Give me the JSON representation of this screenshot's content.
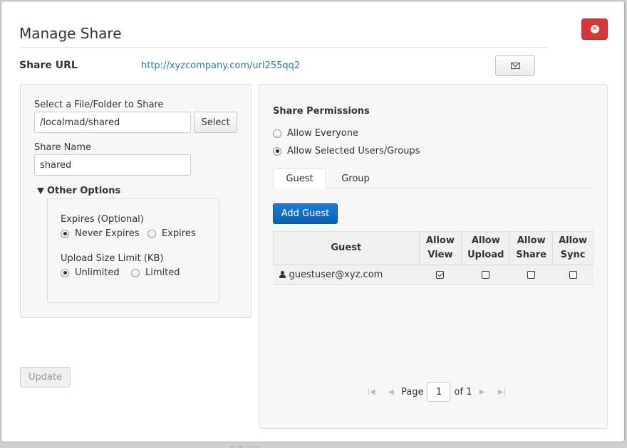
{
  "dialog": {
    "title": "Manage Share",
    "close_icon": "close-circle-icon"
  },
  "share_url": {
    "label": "Share URL",
    "value": "http://xyzcompany.com/url255qq2",
    "email_icon": "envelope-icon"
  },
  "left": {
    "file_label": "Select a File/Folder to Share",
    "file_value": "/localmad/shared",
    "select_label": "Select",
    "name_label": "Share Name",
    "name_value": "shared",
    "other_options_label": "Other Options",
    "expires_label": "Expires (Optional)",
    "expires_options": [
      "Never Expires",
      "Expires"
    ],
    "expires_selected": "Never Expires",
    "upload_label": "Upload Size Limit (KB)",
    "upload_options": [
      "Unlimited",
      "Limited"
    ],
    "upload_selected": "Unlimited",
    "update_label": "Update"
  },
  "right": {
    "permissions_title": "Share Permissions",
    "permission_options": [
      "Allow Everyone",
      "Allow Selected Users/Groups"
    ],
    "permission_selected": "Allow Selected Users/Groups",
    "tabs": [
      "Guest",
      "Group"
    ],
    "active_tab": "Guest",
    "add_guest_label": "Add Guest",
    "table": {
      "headers": {
        "guest": "Guest",
        "view": [
          "Allow",
          "View"
        ],
        "upload": [
          "Allow",
          "Upload"
        ],
        "share": [
          "Allow",
          "Share"
        ],
        "sync": [
          "Allow",
          "Sync"
        ]
      },
      "rows": [
        {
          "guest": "guestuser@xyz.com",
          "view": true,
          "upload": false,
          "share": false,
          "sync": false
        }
      ]
    },
    "pager": {
      "page_label": "Page",
      "page_value": "1",
      "of_label": "of 1"
    }
  },
  "footer_text": "... ... ... ..."
}
